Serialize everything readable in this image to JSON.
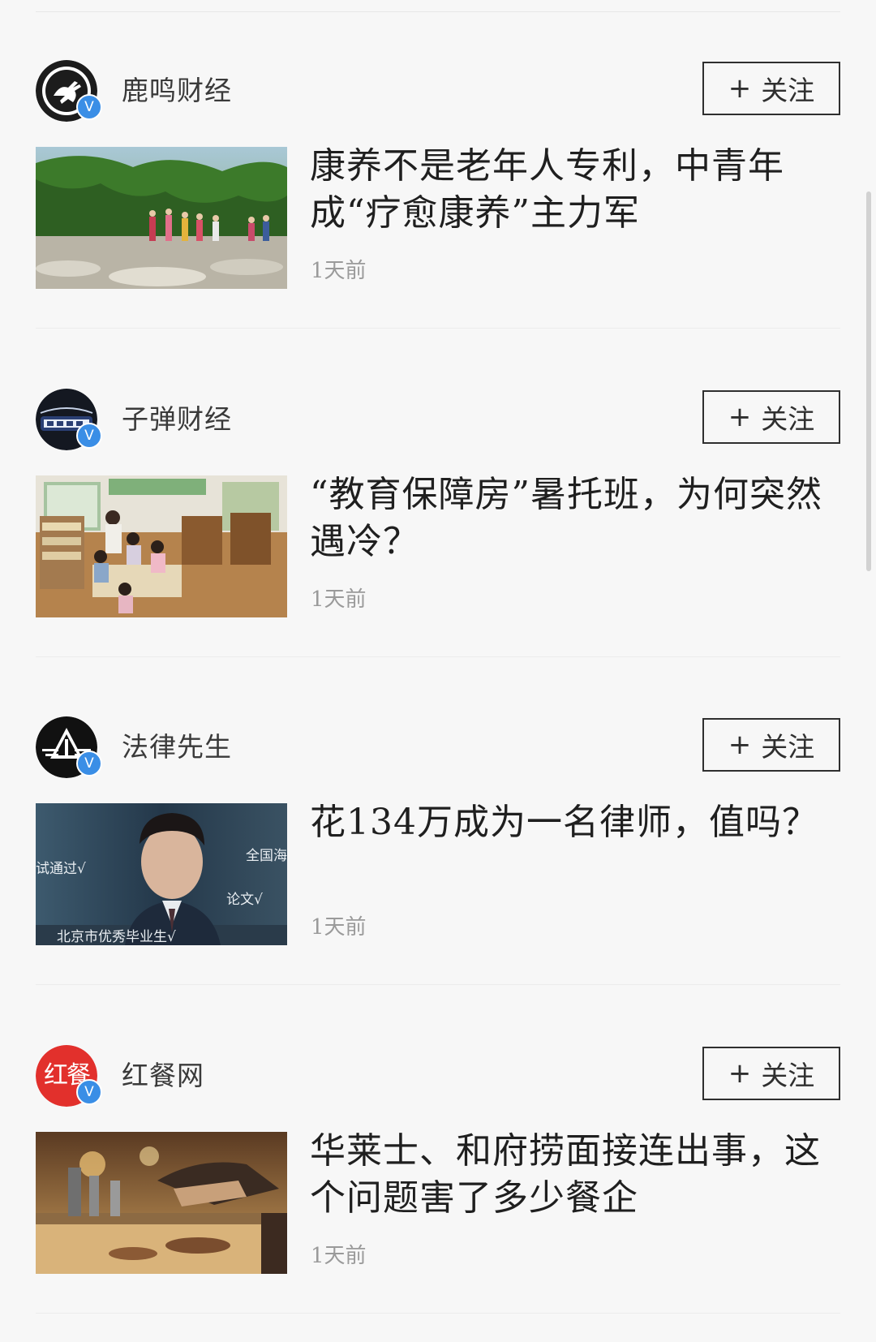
{
  "feed": {
    "items": [
      {
        "author": "鹿鸣财经",
        "verified_badge": "V",
        "follow_label": "关注",
        "follow_icon": "plus-icon",
        "headline": "康养不是老年人专利，中青年成“疗愈康养”主力军",
        "time": "1天前",
        "thumbnail": "hikers-crossing-stream-photo"
      },
      {
        "author": "子弹财经",
        "verified_badge": "V",
        "follow_label": "关注",
        "follow_icon": "plus-icon",
        "headline": "“教育保障房”暑托班，为何突然遇冷？",
        "time": "1天前",
        "thumbnail": "children-classroom-photo"
      },
      {
        "author": "法律先生",
        "verified_badge": "V",
        "follow_label": "关注",
        "follow_icon": "plus-icon",
        "headline": "花134万成为一名律师，值吗？",
        "time": "1天前",
        "thumbnail": "lawyer-portrait-photo",
        "thumbnail_text": {
          "left": "试通过√",
          "right_top": "全国海",
          "right_mid": "论文√",
          "bottom": "北京市优秀毕业生√"
        }
      },
      {
        "author": "红餐网",
        "verified_badge": "V",
        "follow_label": "关注",
        "follow_icon": "plus-icon",
        "headline": "华莱士、和府捞面接连出事，这个问题害了多少餐企",
        "time": "1天前",
        "thumbnail": "restaurant-grill-photo",
        "avatar_text": "红餐"
      }
    ]
  },
  "colors": {
    "background": "#f7f7f7",
    "verified_badge": "#3a8ee6",
    "timestamp": "#9a9a9a",
    "follow_border": "#2f2f2f"
  }
}
